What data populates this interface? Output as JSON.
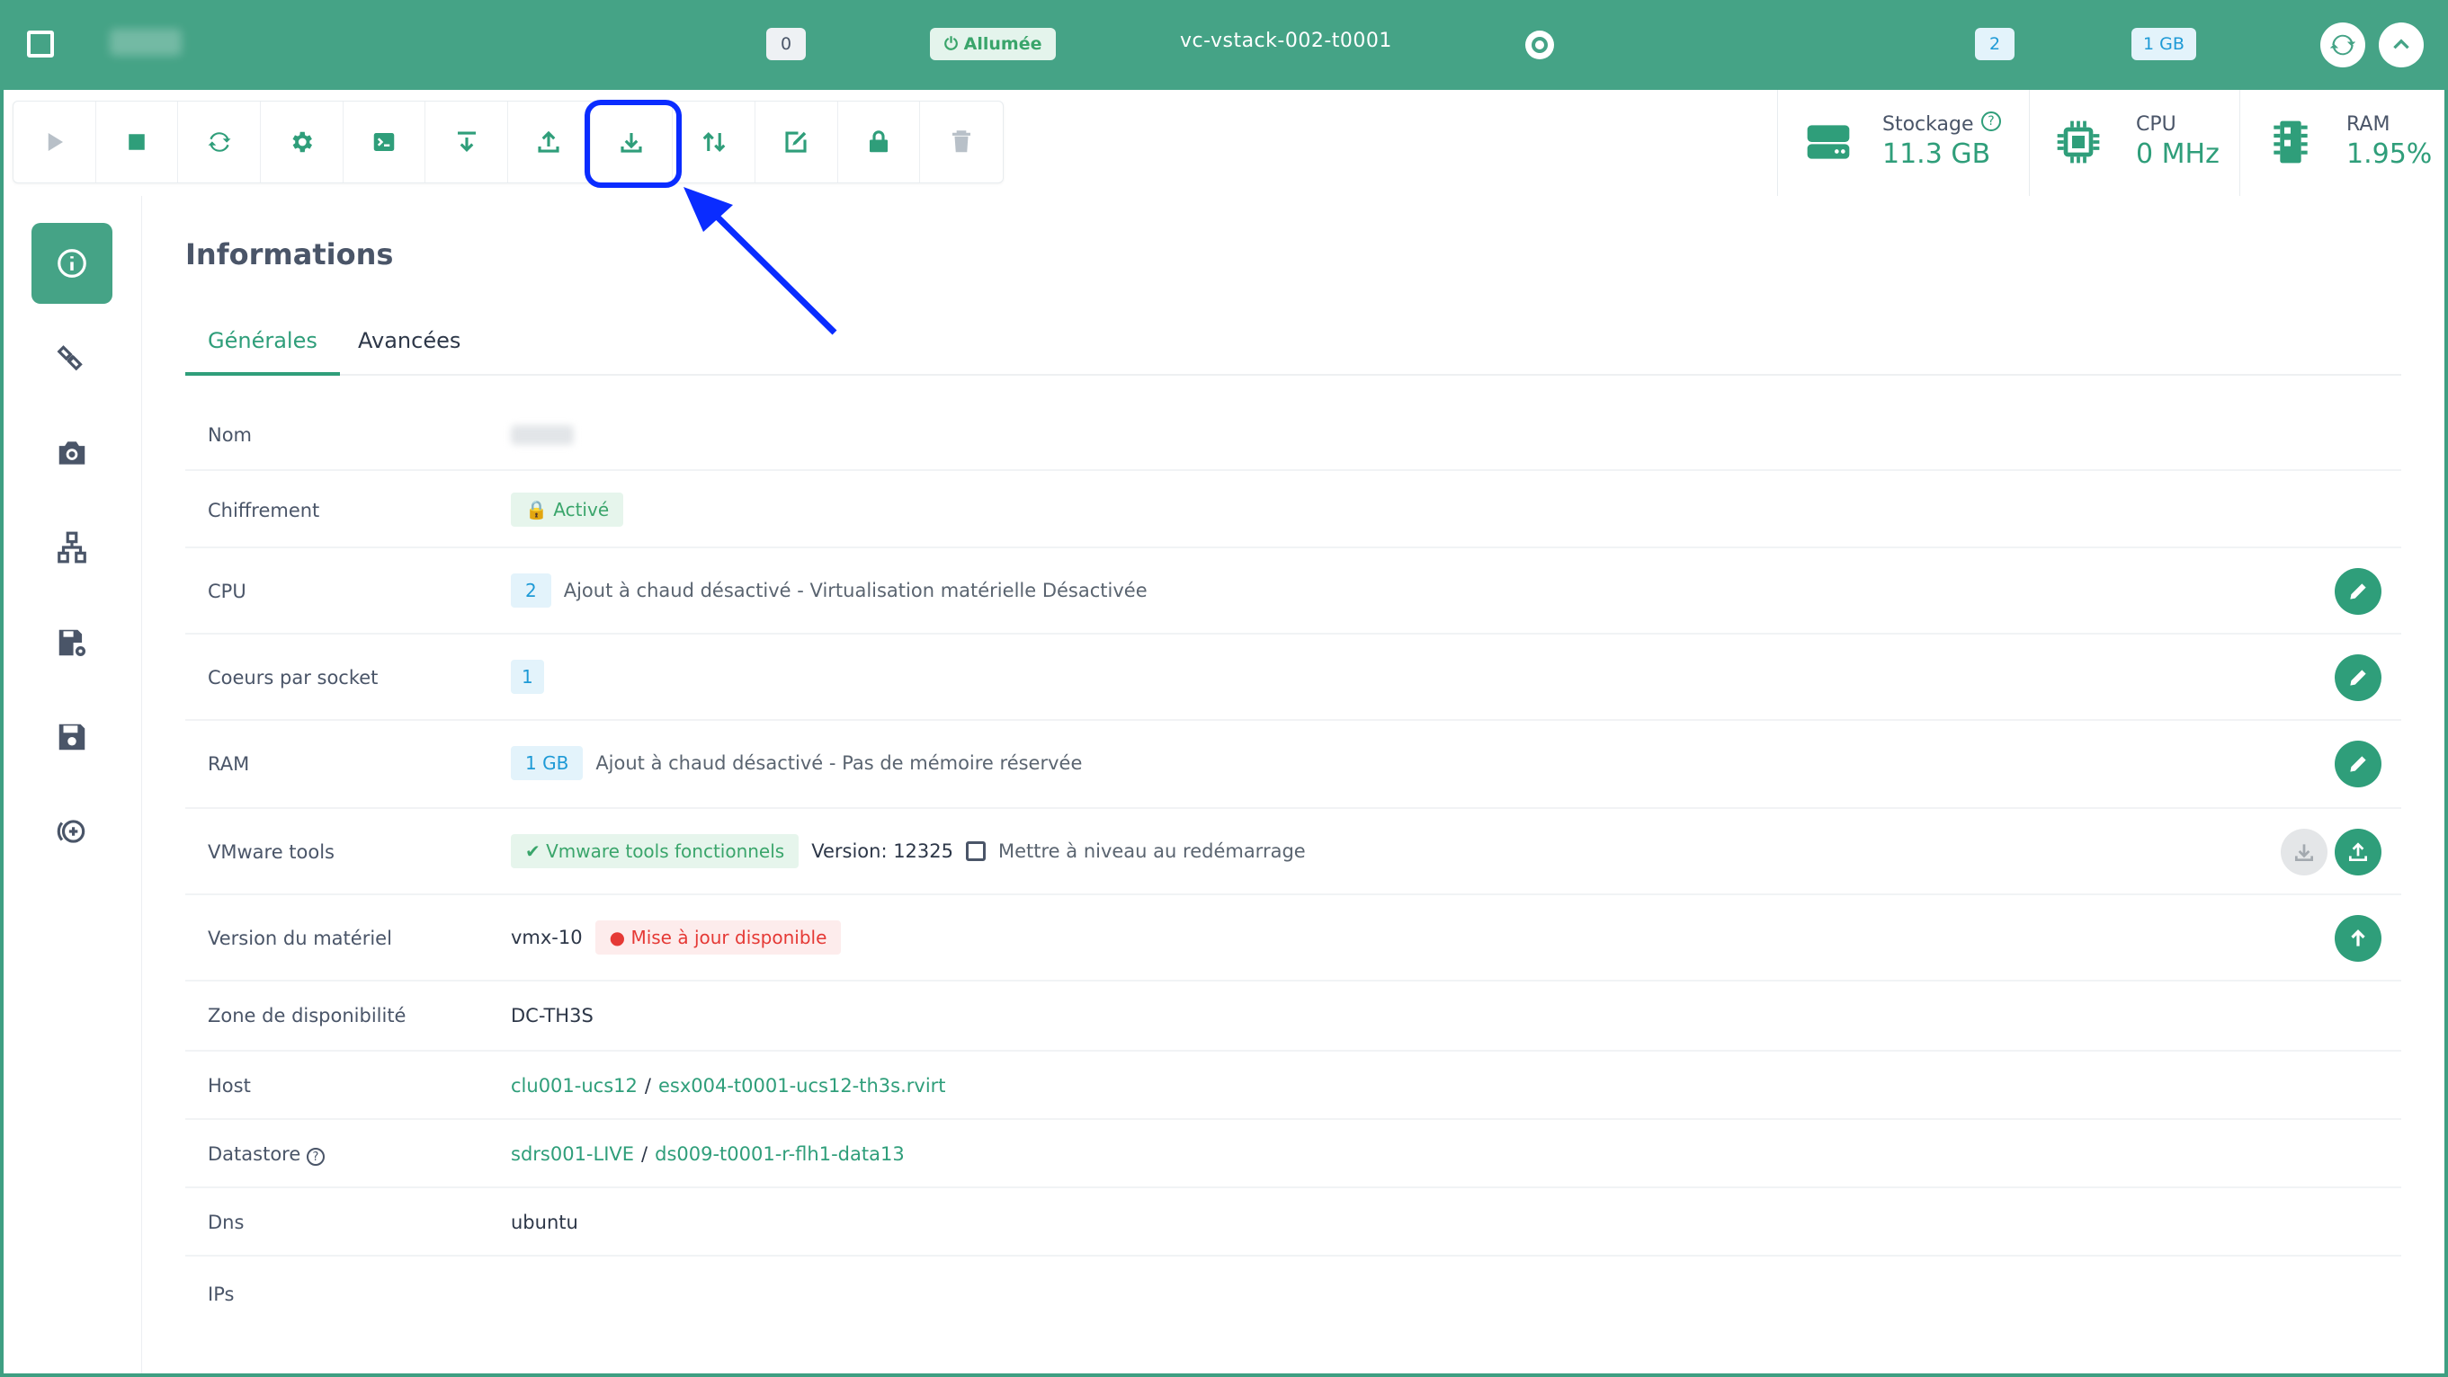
{
  "topbar": {
    "badge_count": "0",
    "status": "Allumée",
    "vm_title": "vc-vstack-002-t0001",
    "cpu_badge": "2",
    "ram_badge": "1 GB"
  },
  "toolbar": {
    "tools": [
      "play-icon",
      "stop-icon",
      "restart-icon",
      "gear-icon",
      "console-icon",
      "import-icon",
      "upload-icon",
      "download-icon",
      "migrate-icon",
      "edit-icon",
      "lock-icon",
      "trash-icon"
    ]
  },
  "stats": {
    "storage": {
      "label": "Stockage",
      "value": "11.3 GB"
    },
    "cpu": {
      "label": "CPU",
      "value": "0 MHz"
    },
    "ram": {
      "label": "RAM",
      "value": "1.95%"
    }
  },
  "main": {
    "title": "Informations",
    "tabs": [
      "Générales",
      "Avancées"
    ]
  },
  "rows": {
    "nom": {
      "label": "Nom"
    },
    "chiffrement": {
      "label": "Chiffrement",
      "badge": "Activé"
    },
    "cpu": {
      "label": "CPU",
      "count": "2",
      "text": "Ajout à chaud désactivé - Virtualisation matérielle Désactivée"
    },
    "coeurs": {
      "label": "Coeurs par socket",
      "count": "1"
    },
    "ram": {
      "label": "RAM",
      "count": "1 GB",
      "text": "Ajout à chaud désactivé - Pas de mémoire réservée"
    },
    "vmware": {
      "label": "VMware tools",
      "badge": "Vmware tools fonctionnels",
      "version": "Version: 12325",
      "checkbox_label": "Mettre à niveau au redémarrage"
    },
    "hardware": {
      "label": "Version du matériel",
      "version": "vmx-10",
      "badge": "Mise à jour disponible"
    },
    "zone": {
      "label": "Zone de disponibilité",
      "value": "DC-TH3S"
    },
    "host": {
      "label": "Host",
      "cluster": "clu001-ucs12",
      "sep": "/",
      "esx": "esx004-t0001-ucs12-th3s.rvirt"
    },
    "datastore": {
      "label": "Datastore",
      "cluster": "sdrs001-LIVE",
      "sep": "/",
      "ds": "ds009-t0001-r-flh1-data13"
    },
    "dns": {
      "label": "Dns",
      "value": "ubuntu"
    },
    "ips": {
      "label": "IPs"
    }
  },
  "colors": {
    "primary": "#45a386",
    "accent": "#2f9e7a",
    "highlight": "#0a2cff"
  }
}
